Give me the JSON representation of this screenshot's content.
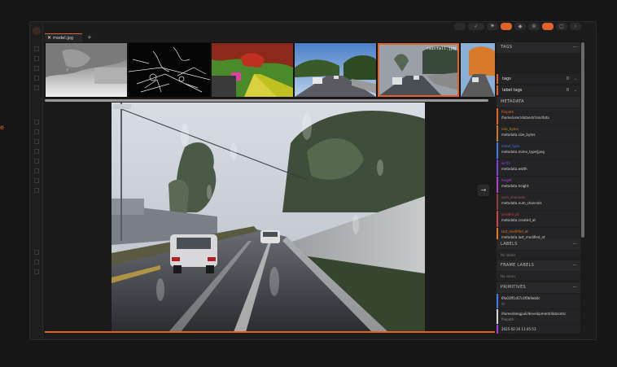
{
  "tab": {
    "close": "✕",
    "label": "model.jpg",
    "add": "+"
  },
  "topbar": {
    "icons": [
      "grid-icon",
      "check-icon",
      "filter-icon",
      "orange-action-icon",
      "tag-icon",
      "gear-icon",
      "wide-accent-icon",
      "window-icon",
      "more-icon"
    ],
    "labels": [
      "",
      "✓",
      "⚑",
      "",
      "◆",
      "⚙",
      "",
      "▢",
      "›"
    ]
  },
  "strip": {
    "selected_index": 4,
    "selected_caption": "rainfall.jpg"
  },
  "viewer": {
    "next_label": "→"
  },
  "side_marker": "e",
  "panel": {
    "tags_header": "TAGS",
    "tags": [
      {
        "label": "tags",
        "count": "0"
      },
      {
        "label": "label tags",
        "count": "0"
      }
    ],
    "metadata_header": "METADATA",
    "metadata": [
      {
        "key": "filepath",
        "value": "/home/user/dataset/rain/data",
        "color": "#e0632a"
      },
      {
        "key": "size_bytes",
        "value": "metadata.size_bytes",
        "color": "#c77a2c"
      },
      {
        "key": "mime_type",
        "value": "metadata.mime_type/jpeg",
        "color": "#3f7de0"
      },
      {
        "key": "width",
        "value": "metadata.width",
        "color": "#7b3fe0"
      },
      {
        "key": "height",
        "value": "metadata.height",
        "color": "#b03fd8"
      },
      {
        "key": "num_channels",
        "value": "metadata.num_channels",
        "color": "#8a3f3f"
      },
      {
        "key": "created_at",
        "value": "metadata.created_at",
        "color": "#d83f3f"
      },
      {
        "key": "last_modified_at",
        "value": "metadata.last_modified_at",
        "color": "#e07a2a"
      }
    ],
    "labels_header": "LABELS",
    "labels_empty": "No labels",
    "frame_labels_header": "FRAME LABELS",
    "frame_labels_empty": "No labels",
    "primitives_header": "PRIMITIVES",
    "primitives": [
      {
        "key": "id",
        "value": "6fa03ff1c67c4f0b9eb0c",
        "color": "#3f7de0"
      },
      {
        "key": "filepath",
        "value": "/home/dongpuli/development/datasets/",
        "color": "#d8d8d8"
      },
      {
        "key": "created_at",
        "value": "2025-02-16 11:45:53",
        "color": "#9a3fd8"
      },
      {
        "key": "last_modified_at",
        "value": "2025-02-16 11:45:53",
        "color": "#e0632a"
      }
    ],
    "collapse_symbol": "—"
  }
}
